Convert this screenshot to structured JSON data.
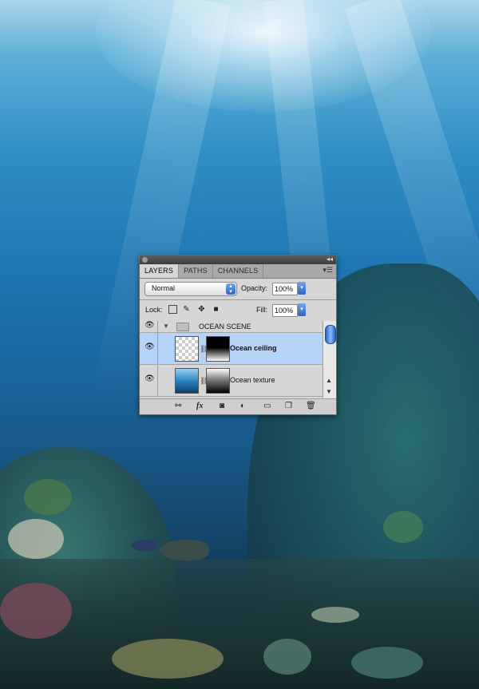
{
  "panel": {
    "tabs": [
      "LAYERS",
      "PATHS",
      "CHANNELS"
    ],
    "active_tab": "LAYERS",
    "blend_mode": "Normal",
    "opacity_label": "Opacity:",
    "opacity_value": "100%",
    "lock_label": "Lock:",
    "fill_label": "Fill:",
    "fill_value": "100%",
    "layers": [
      {
        "name": "OCEAN SCENE",
        "type": "group",
        "visible": true,
        "expanded": true
      },
      {
        "name": "Ocean ceiling",
        "type": "layer",
        "visible": true,
        "selected": true,
        "bold": true
      },
      {
        "name": "Ocean texture",
        "type": "layer",
        "visible": true,
        "selected": false
      }
    ],
    "footer_icons": [
      "link-layers-icon",
      "fx-icon",
      "add-mask-icon",
      "adjustment-layer-icon",
      "new-group-icon",
      "new-layer-icon",
      "delete-layer-icon"
    ],
    "fx_label": "fx",
    "selection_color": "#b5d3f7",
    "accent_color": "#2a63c4"
  }
}
